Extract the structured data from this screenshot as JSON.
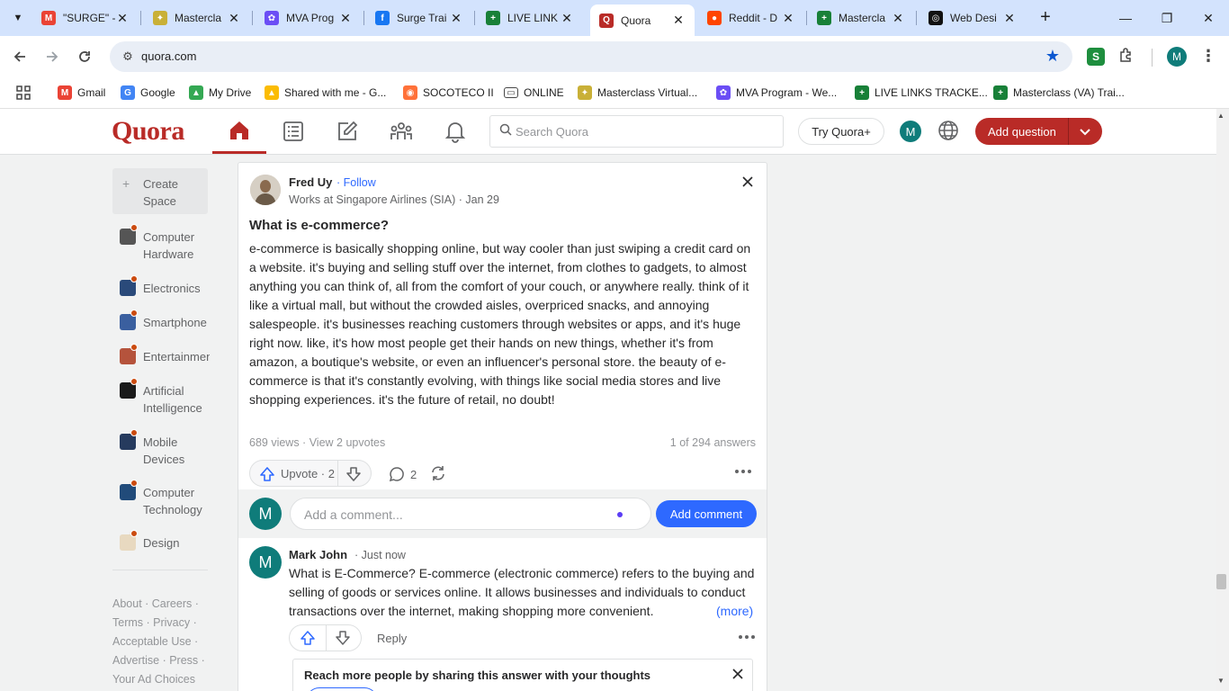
{
  "browser": {
    "tabs": [
      {
        "title": "\"SURGE\" - ",
        "icon": "gmail-icon",
        "color": "#ea4335",
        "glyph": "M"
      },
      {
        "title": "Mastercla",
        "icon": "masterclass-icon",
        "color": "#c9b037",
        "glyph": "✦"
      },
      {
        "title": "MVA Prog",
        "icon": "mva-program-icon",
        "color": "#6b4ef5",
        "glyph": "✿"
      },
      {
        "title": "Surge Trai",
        "icon": "facebook-icon",
        "color": "#1877f2",
        "glyph": "f"
      },
      {
        "title": "LIVE LINK",
        "icon": "sheets-icon",
        "color": "#188038",
        "glyph": "+"
      },
      {
        "title": "Quora",
        "icon": "quora-icon",
        "color": "#b92b27",
        "glyph": "Q",
        "active": true
      },
      {
        "title": "Reddit - D",
        "icon": "reddit-icon",
        "color": "#ff4500",
        "glyph": "●"
      },
      {
        "title": "Mastercla",
        "icon": "sheets-icon",
        "color": "#188038",
        "glyph": "+"
      },
      {
        "title": "Web Desi",
        "icon": "chatgpt-icon",
        "color": "#111111",
        "glyph": "◎"
      }
    ],
    "url": "quora.com",
    "bookmarks": [
      {
        "label": "Gmail",
        "icon": "gmail-icon",
        "color": "#ea4335",
        "glyph": "M"
      },
      {
        "label": "Google",
        "icon": "google-icon",
        "color": "#4285f4",
        "glyph": "G"
      },
      {
        "label": "My Drive",
        "icon": "drive-icon",
        "color": "#34a853",
        "glyph": "▲"
      },
      {
        "label": "Shared with me - G...",
        "icon": "drive-icon",
        "color": "#fbbc04",
        "glyph": "▲"
      },
      {
        "label": "SOCOTECO II",
        "icon": "firefox-icon",
        "color": "#ff7139",
        "glyph": "◉"
      },
      {
        "label": "ONLINE",
        "icon": "folder-icon",
        "color": "#ffffff",
        "glyph": "▭"
      },
      {
        "label": "Masterclass Virtual...",
        "icon": "masterclass-icon",
        "color": "#c9b037",
        "glyph": "✦"
      },
      {
        "label": "MVA Program - We...",
        "icon": "mva-program-icon",
        "color": "#6b4ef5",
        "glyph": "✿"
      },
      {
        "label": "LIVE LINKS TRACKE...",
        "icon": "sheets-icon",
        "color": "#188038",
        "glyph": "+"
      },
      {
        "label": "Masterclass (VA) Trai...",
        "icon": "sheets-icon",
        "color": "#188038",
        "glyph": "+"
      }
    ],
    "profile_initial": "M",
    "extension_initial": "S"
  },
  "quora": {
    "logo": "Quora",
    "search_placeholder": "Search Quora",
    "try_plus": "Try Quora+",
    "avatar_initial": "M",
    "add_question": "Add question",
    "accent": "#b92b27"
  },
  "sidebar": {
    "create_space": "Create Space",
    "spaces": [
      {
        "name": "Computer Hardware",
        "icon_color": "#555555"
      },
      {
        "name": "Electronics",
        "icon_color": "#2a4a7a"
      },
      {
        "name": "Smartphone",
        "icon_color": "#3a5f9f"
      },
      {
        "name": "Entertainment",
        "icon_color": "#b5533c"
      },
      {
        "name": "Artificial Intelligence",
        "icon_color": "#1a1a1a"
      },
      {
        "name": "Mobile Devices",
        "icon_color": "#263b5e"
      },
      {
        "name": "Computer Technology",
        "icon_color": "#214b7a"
      },
      {
        "name": "Design",
        "icon_color": "#e8d9c0"
      }
    ],
    "footer_lines": [
      "About · Careers ·",
      "Terms · Privacy ·",
      "Acceptable Use ·",
      "Advertise · Press ·",
      "Your Ad Choices"
    ]
  },
  "post": {
    "author": "Fred Uy",
    "follow": "· Follow",
    "meta": "Works at Singapore Airlines (SIA) · Jan 29",
    "question": "What is e-commerce?",
    "answer": "e-commerce is basically shopping online, but way cooler than just swiping a credit card on a website. it's buying and selling stuff over the internet, from clothes to gadgets, to almost anything you can think of, all from the comfort of your couch, or anywhere really. think of it like a virtual mall, but without the crowded aisles, overpriced snacks, and annoying salespeople. it's businesses reaching customers through websites or apps, and it's huge right now. like, it's how most people get their hands on new things, whether it's from amazon, a boutique's website, or even an influencer's personal store. the beauty of e-commerce is that it's constantly evolving, with things like social media stores and live shopping experiences. it's the future of retail, no doubt!",
    "stats": "689 views · View 2 upvotes",
    "answers_count": "1 of 294 answers",
    "upvote_label": "Upvote · 2",
    "comment_count": "2"
  },
  "comment_box": {
    "avatar_initial": "M",
    "placeholder": "Add a comment...",
    "submit": "Add comment"
  },
  "comment": {
    "avatar_initial": "M",
    "author": "Mark John",
    "time": "· Just now",
    "text": "What is E-Commerce? E-commerce (electronic commerce) refers to the buying and selling of goods or services online. It allows businesses and individuals to conduct transactions over the internet, making shopping more convenient.",
    "more": "(more)",
    "reply": "Reply"
  },
  "promo": {
    "text": "Reach more people by sharing this answer with your thoughts"
  }
}
